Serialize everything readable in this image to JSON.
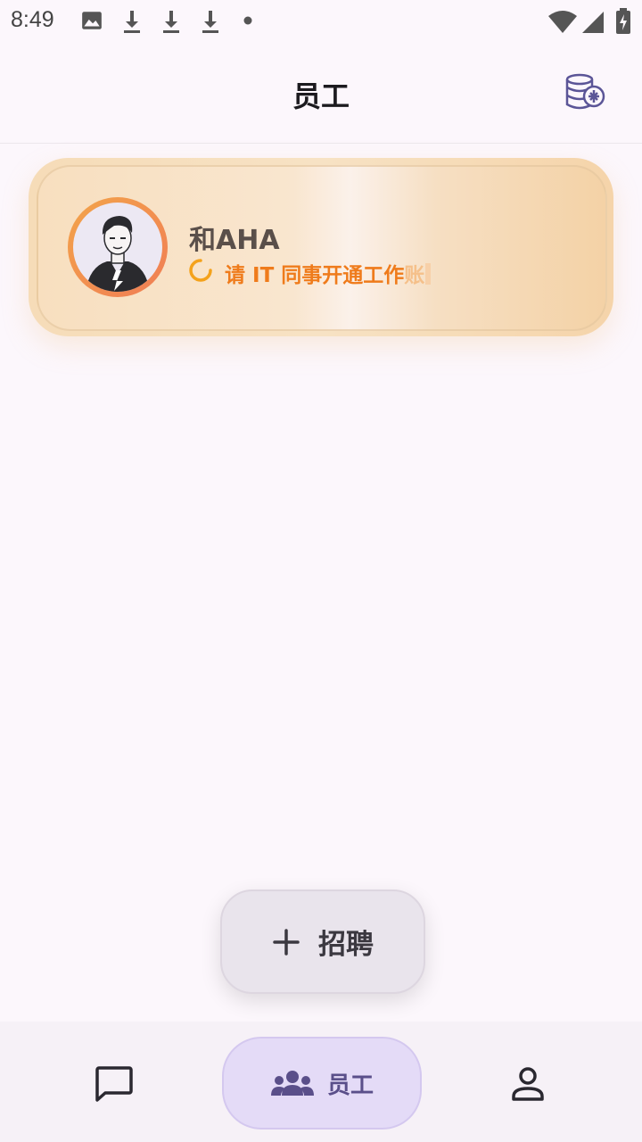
{
  "status_bar": {
    "time": "8:49",
    "left_icons": [
      "image-icon",
      "download-icon",
      "download-icon",
      "download-icon",
      "dot-icon"
    ],
    "right_icons": [
      "wifi-icon",
      "signal-icon",
      "battery-charging-icon"
    ]
  },
  "header": {
    "title": "员工",
    "action_icon": "coin-stack-icon"
  },
  "employee_card": {
    "name": "和AHA",
    "status_main": "请 IT 同事开通工作",
    "status_fading": "账"
  },
  "fab": {
    "icon": "plus-icon",
    "label": "招聘"
  },
  "bottom_nav": {
    "items": [
      {
        "icon": "chat-icon",
        "label": ""
      },
      {
        "icon": "group-icon",
        "label": "员工",
        "active": true
      },
      {
        "icon": "person-icon",
        "label": ""
      }
    ]
  },
  "colors": {
    "accent_orange": "#ef7b1b",
    "nav_active_bg": "#e4dbf7",
    "background": "#fcf7fc"
  }
}
